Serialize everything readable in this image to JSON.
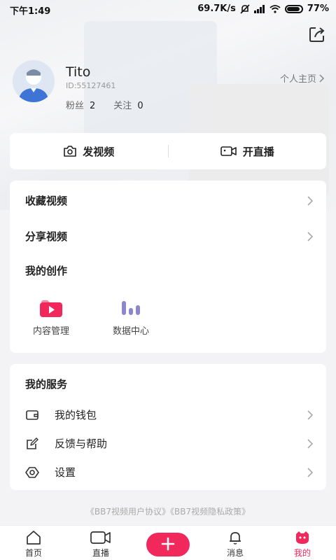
{
  "status_bar": {
    "time": "下午1:49",
    "net_speed": "69.7K/s",
    "battery": "77%"
  },
  "profile": {
    "username": "Tito",
    "user_id": "ID:55127461",
    "fans_label": "粉丝",
    "fans_count": "2",
    "follow_label": "关注",
    "follow_count": "0",
    "homepage_label": "个人主页"
  },
  "actions": {
    "post_video": "发视频",
    "go_live": "开直播"
  },
  "menu": {
    "favorites": "收藏视频",
    "shared": "分享视频",
    "creation_title": "我的创作",
    "content_manage": "内容管理",
    "data_center": "数据中心"
  },
  "services": {
    "title": "我的服务",
    "wallet": "我的钱包",
    "feedback": "反馈与帮助",
    "settings": "设置"
  },
  "agreements": "《BB7视频用户协议》《BB7视频隐私政策》",
  "nav": {
    "home": "首页",
    "live": "直播",
    "messages": "消息",
    "mine": "我的"
  },
  "colors": {
    "accent": "#f0285c",
    "chart_icon": "#8c87cc"
  }
}
